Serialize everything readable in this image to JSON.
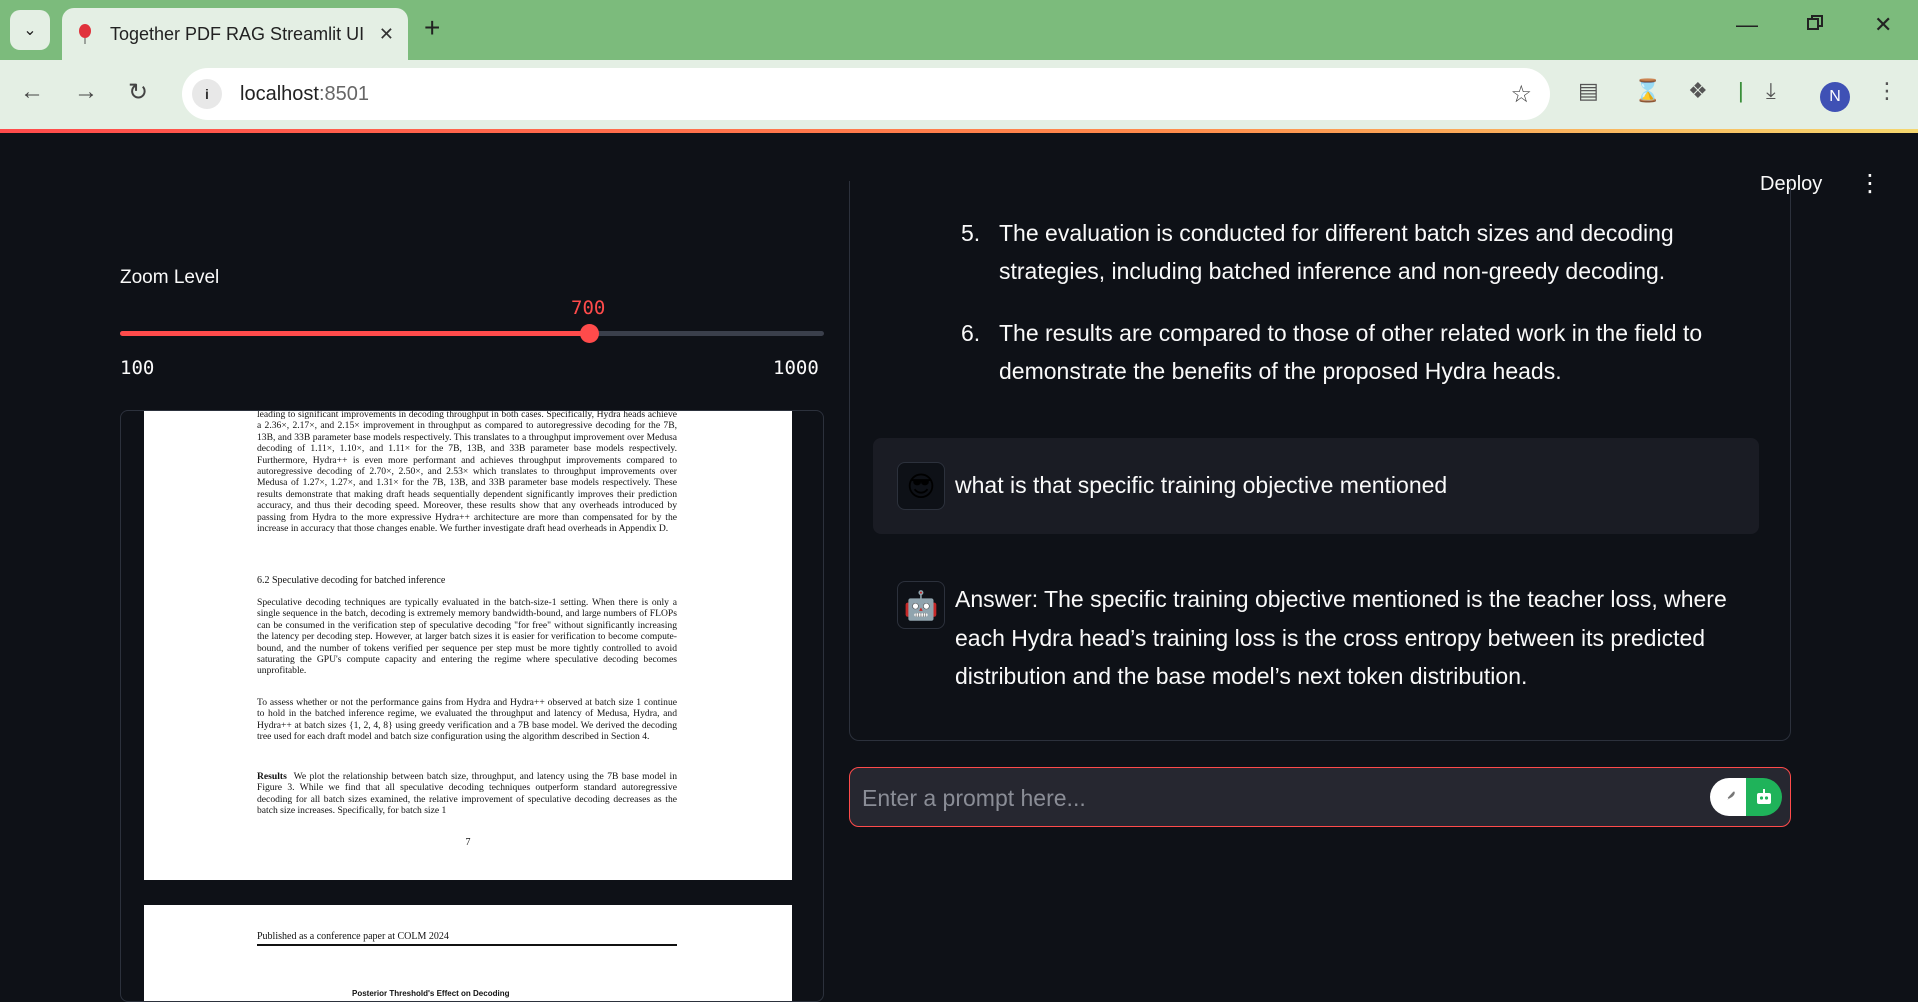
{
  "browser": {
    "tab_title": "Together PDF RAG Streamlit UI",
    "url_host": "localhost",
    "url_port": ":8501",
    "profile_initial": "N"
  },
  "app": {
    "deploy_label": "Deploy"
  },
  "sidebar": {
    "zoom_label": "Zoom Level",
    "zoom_value": 700,
    "zoom_value_text": "700",
    "zoom_min": 100,
    "zoom_min_text": "100",
    "zoom_max": 1000,
    "zoom_max_text": "1000"
  },
  "pdf": {
    "page1_para1": "leading to significant improvements in decoding throughput in both cases. Specifically, Hydra heads achieve a 2.36×, 2.17×, and 2.15× improvement in throughput as compared to autoregressive decoding for the 7B, 13B, and 33B parameter base models respectively. This translates to a throughput improvement over Medusa decoding of 1.11×, 1.10×, and 1.11× for the 7B, 13B, and 33B parameter base models respectively. Furthermore, Hydra++ is even more performant and achieves throughput improvements compared to autoregressive decoding of 2.70×, 2.50×, and 2.53× which translates to throughput improvements over Medusa of 1.27×, 1.27×, and 1.31× for the 7B, 13B, and 33B parameter base models respectively. These results demonstrate that making draft heads sequentially dependent significantly improves their prediction accuracy, and thus their decoding speed. Moreover, these results show that any overheads introduced by passing from Hydra to the more expressive Hydra++ architecture are more than compensated for by the increase in accuracy that those changes enable. We further investigate draft head overheads in Appendix D.",
    "section_heading": "6.2   Speculative decoding for batched inference",
    "page1_para2": "Speculative decoding techniques are typically evaluated in the batch-size-1 setting. When there is only a single sequence in the batch, decoding is extremely memory bandwidth-bound, and large numbers of FLOPs can be consumed in the verification step of speculative decoding \"for free\" without significantly increasing the latency per decoding step. However, at larger batch sizes it is easier for verification to become compute-bound, and the number of tokens verified per sequence per step must be more tightly controlled to avoid saturating the GPU's compute capacity and entering the regime where speculative decoding becomes unprofitable.",
    "page1_para3": "To assess whether or not the performance gains from Hydra and Hydra++ observed at batch size 1 continue to hold in the batched inference regime, we evaluated the throughput and latency of Medusa, Hydra, and Hydra++ at batch sizes {1, 2, 4, 8} using greedy verification and a 7B base model. We derived the decoding tree used for each draft model and batch size configuration using the algorithm described in Section 4.",
    "results_label": "Results",
    "page1_para4": "We plot the relationship between batch size, throughput, and latency using the 7B base model in Figure 3. While we find that all speculative decoding techniques outperform standard autoregressive decoding for all batch sizes examined, the relative improvement of speculative decoding decreases as the batch size increases. Specifically, for batch size 1",
    "page_number": "7",
    "page2_header": "Published as a conference paper at COLM 2024",
    "page2_figure_title": "Posterior Threshold's Effect on Decoding"
  },
  "chat": {
    "list_items": [
      {
        "num": "5.",
        "text": "The evaluation is conducted for different batch sizes and decoding strategies, including batched inference and non-greedy decoding."
      },
      {
        "num": "6.",
        "text": "The results are compared to those of other related work in the field to demonstrate the benefits of the proposed Hydra heads."
      }
    ],
    "user_message": "what is that specific training objective mentioned",
    "assistant_message": "Answer: The specific training objective mentioned is the teacher loss, where each Hydra head’s training loss is the cross entropy between its predicted distribution and the base model’s next token distribution.",
    "prompt_placeholder": "Enter a prompt here..."
  },
  "colors": {
    "accent": "#ff4b4b",
    "background": "#0e1117",
    "chrome_frame": "#7cbb7c",
    "chrome_toolbar": "#e4efe4",
    "send_green": "#1fb35a"
  }
}
